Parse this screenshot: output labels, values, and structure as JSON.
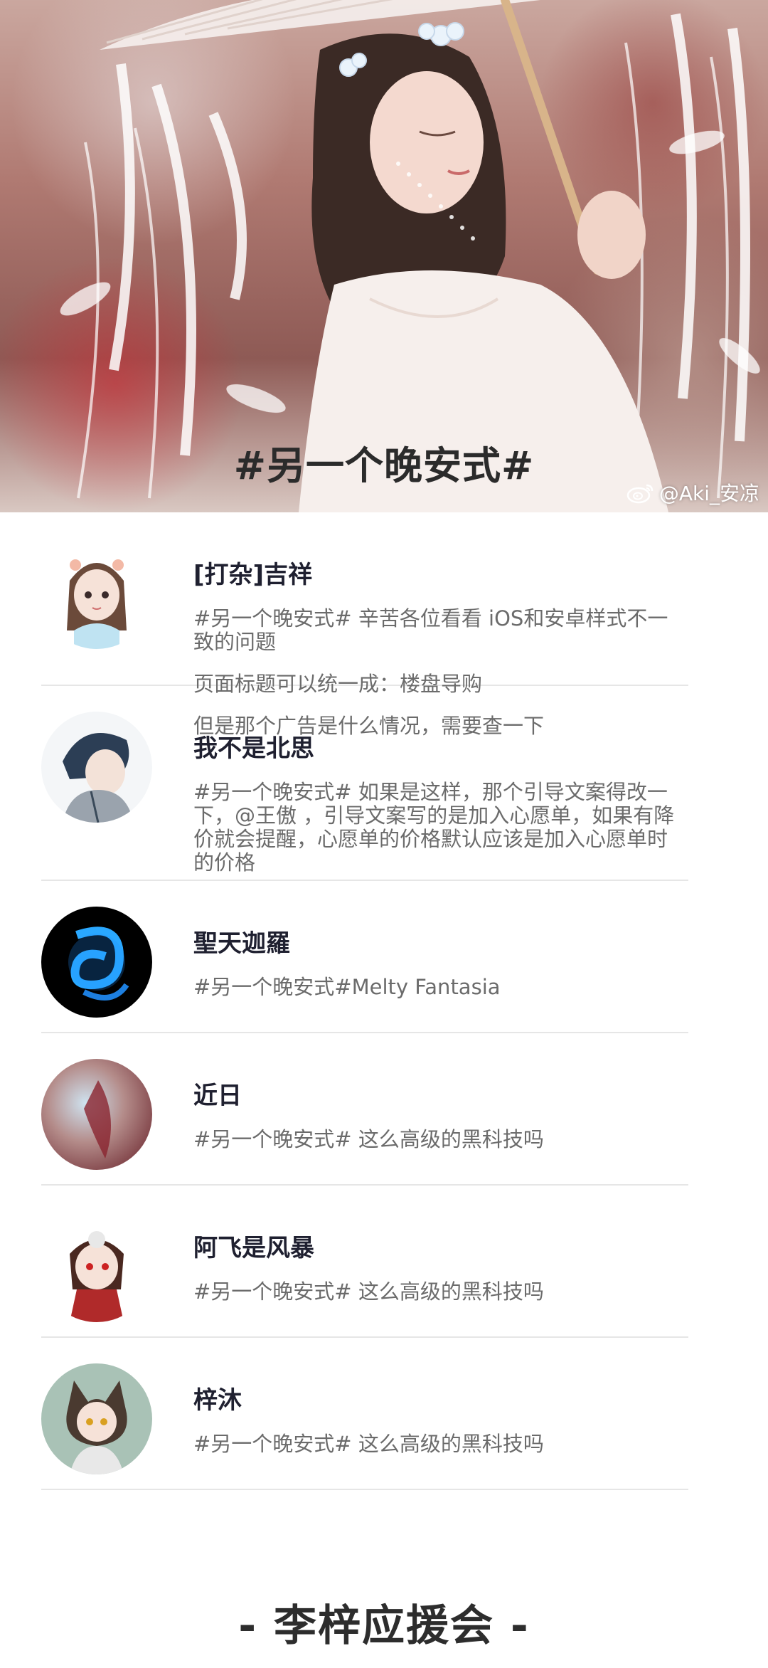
{
  "hero": {
    "title": "#另一个晚安式#",
    "watermark": "@Aki_安凉"
  },
  "comments": [
    {
      "name": "[打杂]吉祥",
      "paragraphs": [
        "#另一个晚安式# 辛苦各位看看 iOS和安卓样式不一致的问题",
        "页面标题可以统一成：楼盘导购",
        "但是那个广告是什么情况，需要查一下"
      ]
    },
    {
      "name": "我不是北思",
      "paragraphs": [
        "#另一个晚安式# 如果是这样，那个引导文案得改一下，@王傲 ，引导文案写的是加入心愿单，如果有降价就会提醒，心愿单的价格默认应该是加入心愿单时的价格"
      ]
    },
    {
      "name": "聖天迦羅",
      "paragraphs": [
        "#另一个晚安式#Melty Fantasia"
      ]
    },
    {
      "name": "近日",
      "paragraphs": [
        "#另一个晚安式# 这么高级的黑科技吗"
      ]
    },
    {
      "name": "阿飞是风暴",
      "paragraphs": [
        "#另一个晚安式# 这么高级的黑科技吗"
      ]
    },
    {
      "name": "梓沐",
      "paragraphs": [
        "#另一个晚安式# 这么高级的黑科技吗"
      ]
    }
  ],
  "footer": {
    "title": "- 李梓应援会 -"
  }
}
